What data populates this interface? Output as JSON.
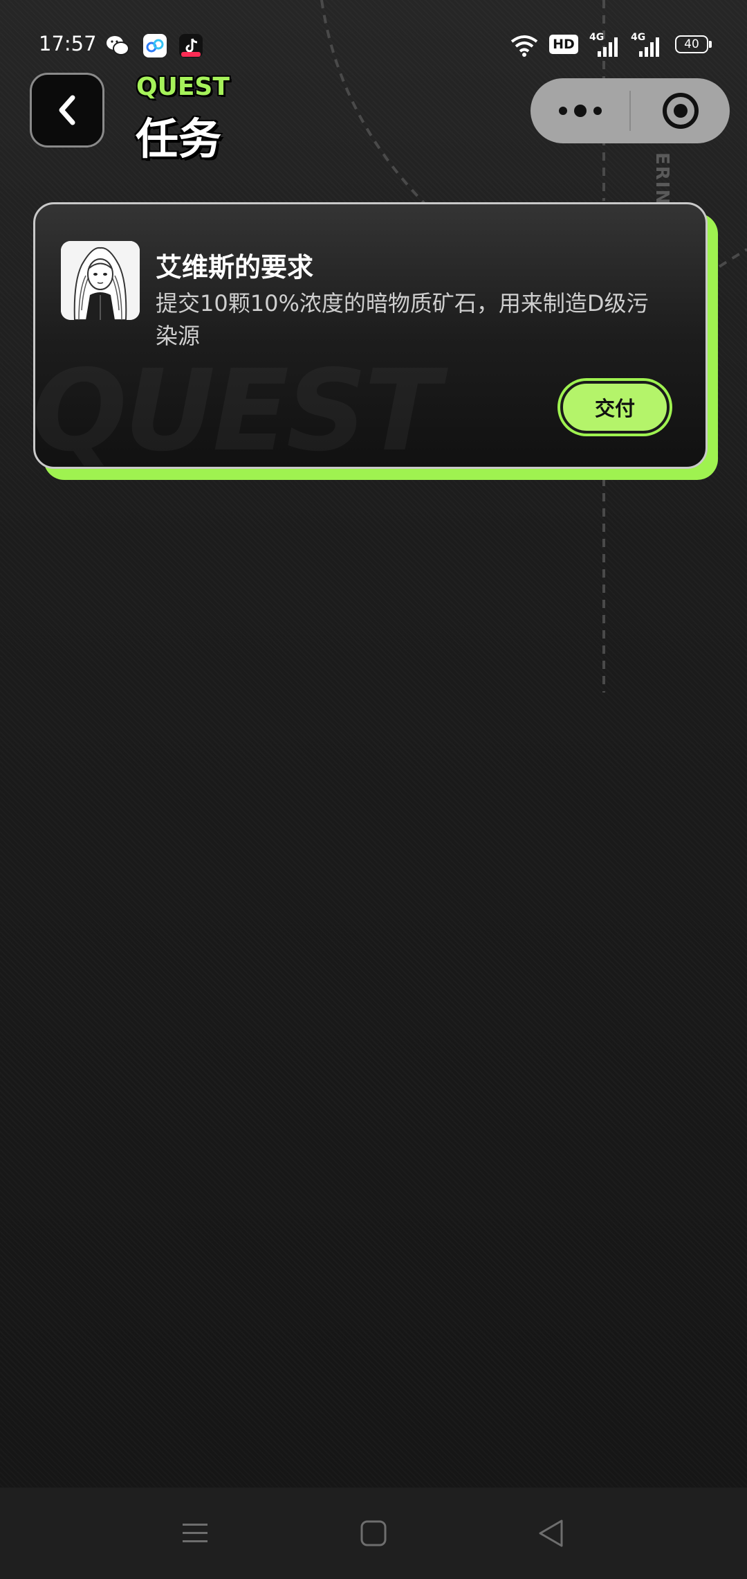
{
  "status_bar": {
    "time": "17:57",
    "battery": "40",
    "network_1": "4G",
    "network_2": "4G",
    "hd_label": "HD",
    "app_icons": [
      "wechat-icon",
      "cloud-drive-icon",
      "tiktok-icon"
    ]
  },
  "header": {
    "title_en": "QUEST",
    "title_cn": "任务",
    "back_icon": "chevron-left-icon"
  },
  "capsule": {
    "more_icon": "more-dots-icon",
    "close_icon": "target-close-icon"
  },
  "quest": {
    "title": "艾维斯的要求",
    "description": "提交10颗10%浓度的暗物质矿石，用来制造D级污染源",
    "submit_label": "交付",
    "watermark": "QUEST"
  },
  "background": {
    "decor_text": "ERING"
  },
  "nav_bar": {
    "menu_icon": "menu-icon",
    "home_icon": "square-home-icon",
    "back_icon": "triangle-back-icon"
  },
  "colors": {
    "accent": "#9ff250",
    "background": "#1a1a1a",
    "card_border": "#c9c9c9"
  }
}
